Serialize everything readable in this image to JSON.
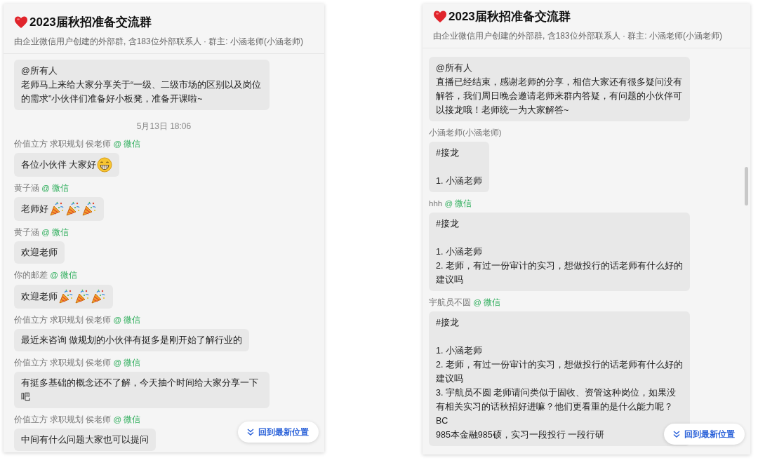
{
  "panels": [
    {
      "title": "2023届秋招准备交流群",
      "subtitle": "由企业微信用户创建的外部群, 含183位外部联系人 · 群主: 小涵老师(小涵老师)",
      "scrollbar": false,
      "jump_button": "回到最新位置",
      "messages": [
        {
          "kind": "message",
          "paragraphs": [
            [
              "@所有人",
              "老师马上来给大家分享关于“一级、二级市场的区别以及岗位的需求”小伙伴们准备好小板凳，准备开课啦~"
            ]
          ]
        },
        {
          "kind": "time",
          "text": "5月13日 18:06"
        },
        {
          "kind": "message",
          "sender": "价值立方 求职规划 侯老师",
          "source": "@ 微信",
          "paragraphs": [
            [
              "各位小伙伴 大家好"
            ]
          ],
          "emojis": [
            {
              "kind": "grin"
            }
          ]
        },
        {
          "kind": "message",
          "sender": "黄子涵",
          "source": "@ 微信",
          "paragraphs": [
            [
              "老师好"
            ]
          ],
          "emojis": [
            {
              "kind": "party"
            },
            {
              "kind": "party"
            },
            {
              "kind": "party"
            }
          ]
        },
        {
          "kind": "message",
          "sender": "黄子涵",
          "source": "@ 微信",
          "paragraphs": [
            [
              "欢迎老师"
            ]
          ]
        },
        {
          "kind": "message",
          "sender": "你的邮差",
          "source": "@ 微信",
          "paragraphs": [
            [
              "欢迎老师"
            ]
          ],
          "emojis": [
            {
              "kind": "party"
            },
            {
              "kind": "party"
            },
            {
              "kind": "party"
            }
          ]
        },
        {
          "kind": "message",
          "sender": "价值立方 求职规划 侯老师",
          "source": "@ 微信",
          "paragraphs": [
            [
              "最近来咨询 做规划的小伙伴有挺多是刚开始了解行业的"
            ]
          ]
        },
        {
          "kind": "message",
          "sender": "价值立方 求职规划 侯老师",
          "source": "@ 微信",
          "paragraphs": [
            [
              "有挺多基础的概念还不了解，今天抽个时间给大家分享一下吧"
            ]
          ]
        },
        {
          "kind": "message",
          "sender": "价值立方 求职规划 侯老师",
          "source": "@ 微信",
          "paragraphs": [
            [
              "中间有什么问题大家也可以提问"
            ]
          ]
        }
      ]
    },
    {
      "title": "2023届秋招准备交流群",
      "subtitle": "由企业微信用户创建的外部群, 含183位外部联系人 · 群主: 小涵老师(小涵老师)",
      "scrollbar": true,
      "jump_button": "回到最新位置",
      "messages": [
        {
          "kind": "message",
          "paragraphs": [
            [
              "@所有人",
              "直播已经结束，感谢老师的分享，相信大家还有很多疑问没有解答，我们周日晚会邀请老师来群内答疑，有问题的小伙伴可以接龙哦！老师统一为大家解答~"
            ]
          ]
        },
        {
          "kind": "message",
          "sender": "小涵老师(小涵老师)",
          "paragraphs": [
            [
              "#接龙"
            ],
            [
              "1. 小涵老师"
            ]
          ]
        },
        {
          "kind": "message",
          "sender": "hhh",
          "source": "@ 微信",
          "paragraphs": [
            [
              "#接龙"
            ],
            [
              "1. 小涵老师",
              "2. 老师，有过一份审计的实习，想做投行的话老师有什么好的建议吗"
            ]
          ]
        },
        {
          "kind": "message",
          "sender": "宇航员不圆",
          "source": "@ 微信",
          "paragraphs": [
            [
              "#接龙"
            ],
            [
              "1. 小涵老师",
              "2. 老师，有过一份审计的实习，想做投行的话老师有什么好的建议吗",
              "3. 宇航员不圆 老师请问类似于固收、资管这种岗位，如果没有相关实习的话秋招好进嘛？他们更看重的是什么能力呢？BC",
              "985本金融985硕，实习一段投行 一段行研"
            ]
          ]
        }
      ]
    }
  ]
}
